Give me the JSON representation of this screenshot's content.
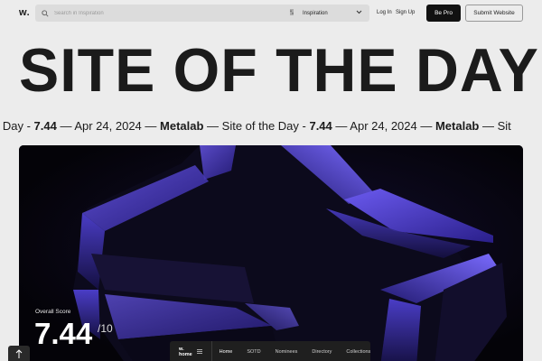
{
  "header": {
    "logo": "w.",
    "search_placeholder": "Search in Inspiration",
    "filter_icon": "filter-icon",
    "category": "Inspiration",
    "login": "Log In",
    "signup": "Sign Up",
    "be_pro": "Be Pro",
    "submit": "Submit Website"
  },
  "hero": {
    "title": "SITE OF THE DAY",
    "ticker": [
      {
        "t": "e Day - ",
        "b": false
      },
      {
        "t": "7.44",
        "b": true
      },
      {
        "t": " — Apr 24, 2024 — ",
        "b": false
      },
      {
        "t": "Metalab",
        "b": true
      },
      {
        "t": " — Site of the Day - ",
        "b": false
      },
      {
        "t": "7.44",
        "b": true
      },
      {
        "t": " — Apr 24, 2024 — ",
        "b": false
      },
      {
        "t": "Metalab",
        "b": true
      },
      {
        "t": " — Sit",
        "b": false
      }
    ]
  },
  "score": {
    "label": "Overall Score",
    "value": "7.44",
    "max": "/10"
  },
  "bottom_nav": {
    "home": "w. home",
    "items": [
      "Home",
      "SOTD",
      "Nominees",
      "Directory",
      "Collections"
    ]
  },
  "colors": {
    "accent_purple": "#5a4bd6",
    "dark": "#111111"
  }
}
